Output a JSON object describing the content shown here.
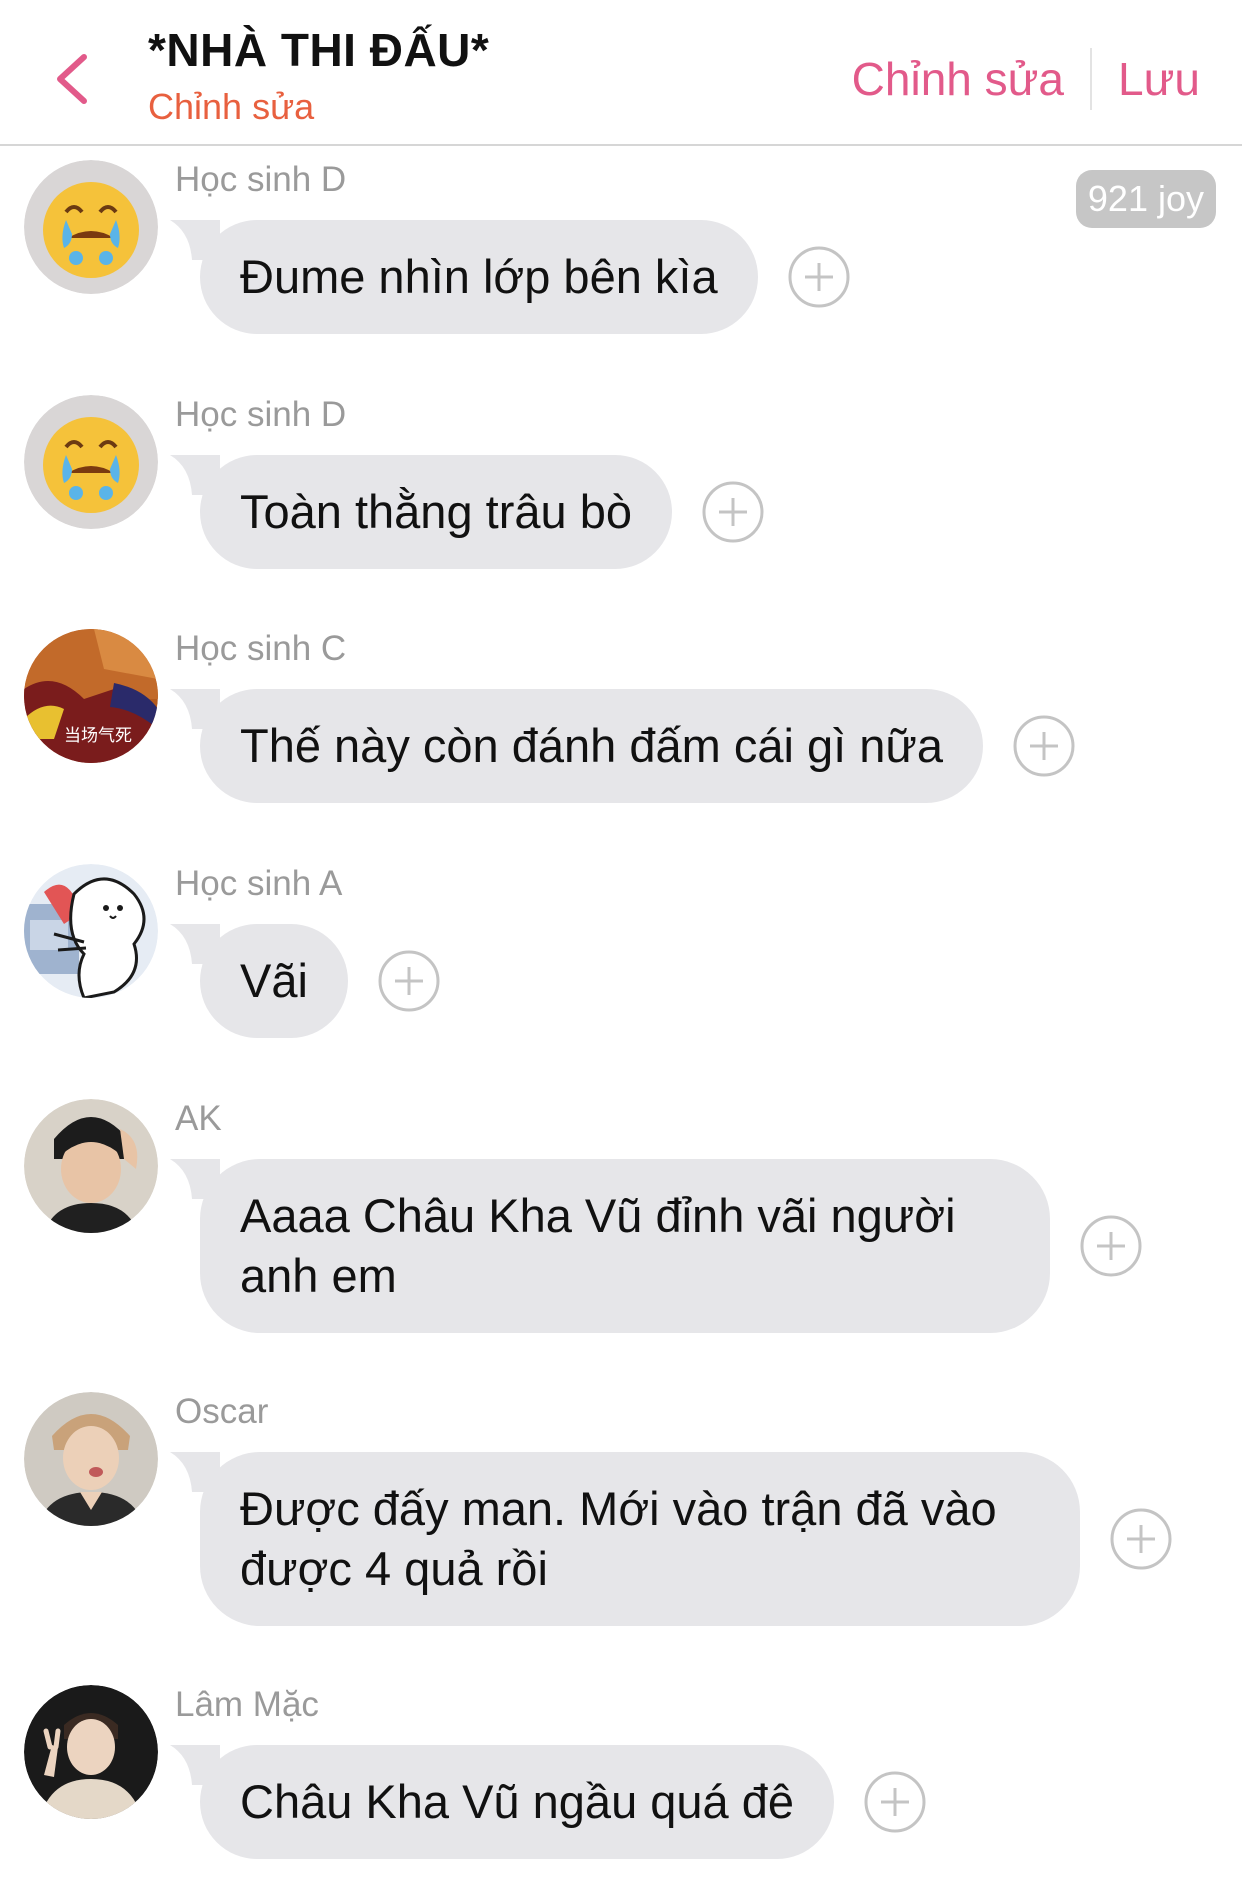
{
  "header": {
    "title": "*NHÀ THI ĐẤU*",
    "subtitle": "Chỉnh sửa",
    "edit_label": "Chỉnh sửa",
    "save_label": "Lưu"
  },
  "badge": "921 joy",
  "messages": [
    {
      "sender": "Học sinh D",
      "text": "Đume nhìn lớp bên kìa",
      "avatar": "crying-emoji"
    },
    {
      "sender": "Học sinh D",
      "text": "Toàn thằng trâu bò",
      "avatar": "crying-emoji"
    },
    {
      "sender": "Học sinh C",
      "text": "Thế này còn đánh đấm cái gì nữa",
      "avatar": "cartoon-sticker",
      "avatar_text": "当场气死"
    },
    {
      "sender": "Học sinh A",
      "text": "Vãi",
      "avatar": "bear-doodle"
    },
    {
      "sender": "AK",
      "text": "Aaaa Châu Kha Vũ đỉnh vãi người anh em",
      "avatar": "person-photo"
    },
    {
      "sender": "Oscar",
      "text": "Được đấy man. Mới vào trận đã vào được 4 quả rồi",
      "avatar": "person-photo"
    },
    {
      "sender": "Lâm Mặc",
      "text": "Châu Kha Vũ ngầu quá đê",
      "avatar": "person-photo"
    }
  ],
  "colors": {
    "accent": "#e25a8a",
    "subtitle": "#e8603f",
    "bubble": "#e6e6e9",
    "sender": "#9a9a9a",
    "badge": "#c6c6c6"
  }
}
